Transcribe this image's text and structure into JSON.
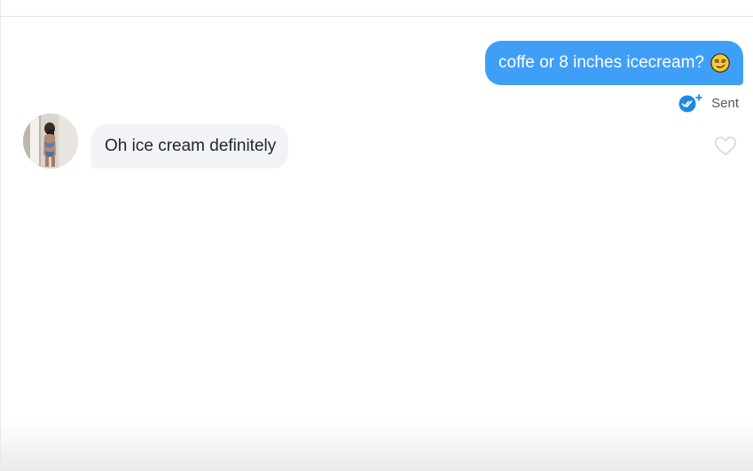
{
  "conversation": {
    "messages": [
      {
        "direction": "outgoing",
        "text": "coffe or 8 inches icecream?",
        "emoji_icon": "smirking-face-emoji",
        "status_text": "Sent",
        "status_icon": "double-check-plus-icon"
      },
      {
        "direction": "incoming",
        "text": "Oh ice cream definitely",
        "avatar": "avatar-photo",
        "like_icon": "heart-outline-icon"
      }
    ]
  },
  "colors": {
    "sent_bubble": "#3f9ff7",
    "received_bubble": "#f2f3f7",
    "status_check": "#1d89e4",
    "heart_outline": "#d6d6dc"
  }
}
